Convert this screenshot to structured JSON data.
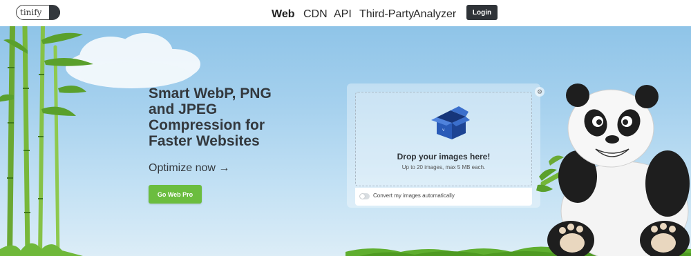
{
  "header": {
    "logo_text": "tinify",
    "nav": [
      {
        "label": "Web",
        "active": true
      },
      {
        "label": "CDN",
        "active": false
      },
      {
        "label": "API",
        "active": false
      },
      {
        "label": "Third-Party",
        "active": false
      },
      {
        "label": "Analyzer",
        "active": false
      }
    ],
    "login_label": "Login"
  },
  "hero": {
    "headline_lines": [
      "Smart WebP, PNG",
      "and JPEG",
      "Compression for",
      "Faster Websites"
    ],
    "optimize_link": "Optimize now →",
    "cta_label": "Go Web Pro"
  },
  "dropzone": {
    "title": "Drop your images here!",
    "subtitle": "Up to 20 images, max 5 MB each.",
    "convert_label": "Convert my images automatically",
    "convert_enabled": false
  },
  "colors": {
    "cta_green": "#6bbd3f",
    "login_dark": "#2f3338",
    "sky_blue": "#8fc4e8",
    "box_blue": "#2a5bb8"
  }
}
